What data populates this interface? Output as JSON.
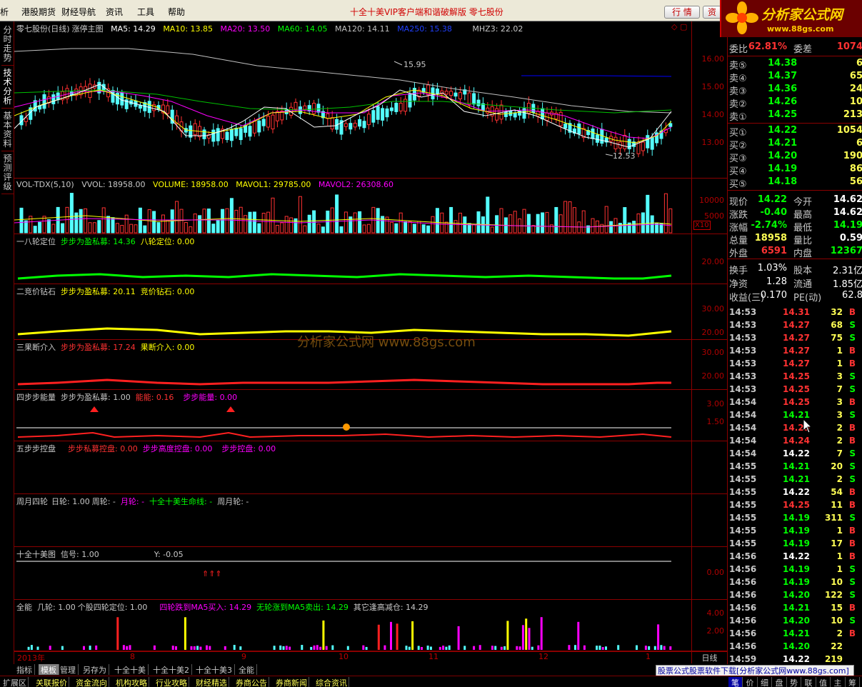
{
  "menu": {
    "items": [
      "析",
      "港股期货",
      "财经导航",
      "资讯",
      "工具",
      "帮助"
    ],
    "promo": "十全十美VIP客户端和谐破解版  零七股份",
    "btn_quote": "行 情",
    "btn_info": "资"
  },
  "logo": {
    "text": "分析家公式网",
    "url": "www.88gs.com"
  },
  "left_tabs": [
    "分时走势",
    "技术分析",
    "基本资料",
    "预测评级"
  ],
  "main": {
    "stock": "零七股份(日线)",
    "indicator": "涨停主图",
    "ma5": "MA5: 14.29",
    "ma10": "MA10: 13.85",
    "ma20": "MA20: 13.50",
    "ma60": "MA60: 14.05",
    "ma120": "MA120: 14.11",
    "ma250": "MA250: 15.38",
    "mhz3": "MHZ3: 22.02",
    "high": "15.95",
    "low": "12.53",
    "ticks": [
      "16.00",
      "15.00",
      "14.00",
      "13.00"
    ]
  },
  "vol": {
    "name": "VOL-TDX(5,10)",
    "vvol": "VVOL: 18958.00",
    "volume": "VOLUME: 18958.00",
    "mavol1": "MAVOL1: 29785.00",
    "mavol2": "MAVOL2: 26308.60",
    "ticks": [
      "10000",
      "5000"
    ],
    "unit": "X10"
  },
  "p1": {
    "name": "一八轮定位",
    "l1": "步步为盈私募: 14.36",
    "l2": "八轮定位: 0.00",
    "ticks": [
      "20.00"
    ]
  },
  "p2": {
    "name": "二竞价钻石",
    "l1": "步步为盈私募: 20.11",
    "l2": "竞价钻石: 0.00",
    "ticks": [
      "30.00",
      "20.00"
    ]
  },
  "p3": {
    "name": "三果断介入",
    "l1": "步步为盈私募: 17.24",
    "l2": "果断介入: 0.00",
    "ticks": [
      "30.00",
      "20.00"
    ]
  },
  "p4": {
    "name": "四步步能量",
    "l1": "步步为盈私募: 1.00",
    "l2": "能能: 0.16",
    "l3": "步步能量: 0.00",
    "ticks": [
      "3.00",
      "1.50"
    ]
  },
  "p5": {
    "name": "五步步控盘",
    "l1": "步步私募控盘: 0.00",
    "l2": "步步高度控盘: 0.00",
    "l3": "步步控盘: 0.00"
  },
  "p6": {
    "name": "周月四轮",
    "l1": "日轮: 1.00",
    "l2": "周轮: -",
    "l3": "月轮: -",
    "l4": "十全十美生命线: -",
    "l5": "周月轮: -"
  },
  "p7": {
    "name": "十全十美图",
    "l1": "信号: 1.00",
    "l2": "Y: -0.05",
    "ticks": [
      "0.00"
    ]
  },
  "p8": {
    "name": "全能",
    "l1": "几轮: 1.00",
    "l2": "个股四轮定位: 1.00",
    "l3": "四轮跌到MA5买入: 14.29",
    "l4": "无轮涨到MA5卖出: 14.29",
    "l5": "其它逢高减仓: 14.29",
    "ticks": [
      "4.00",
      "2.00"
    ]
  },
  "xaxis": {
    "labels": [
      "2013年",
      "8",
      "9",
      "10",
      "11",
      "12",
      "1"
    ],
    "period": "日线"
  },
  "watermark": "分析家公式网 www.88gs.com",
  "quote": {
    "weibi_label": "委比",
    "weibi": "62.81%",
    "weicha_label": "委差",
    "weicha": "1074",
    "sells": [
      {
        "l": "卖⑤",
        "p": "14.38",
        "v": "6"
      },
      {
        "l": "卖④",
        "p": "14.37",
        "v": "65"
      },
      {
        "l": "卖③",
        "p": "14.36",
        "v": "24"
      },
      {
        "l": "卖②",
        "p": "14.26",
        "v": "10"
      },
      {
        "l": "卖①",
        "p": "14.25",
        "v": "213"
      }
    ],
    "buys": [
      {
        "l": "买①",
        "p": "14.22",
        "v": "1054"
      },
      {
        "l": "买②",
        "p": "14.21",
        "v": "6"
      },
      {
        "l": "买③",
        "p": "14.20",
        "v": "190"
      },
      {
        "l": "买④",
        "p": "14.19",
        "v": "86"
      },
      {
        "l": "买⑤",
        "p": "14.18",
        "v": "56"
      }
    ],
    "stats": [
      {
        "l1": "现价",
        "v1": "14.22",
        "l2": "今开",
        "v2": "14.62"
      },
      {
        "l1": "涨跌",
        "v1": "-0.40",
        "l2": "最高",
        "v2": "14.62"
      },
      {
        "l1": "涨幅",
        "v1": "-2.74%",
        "l2": "最低",
        "v2": "14.19"
      },
      {
        "l1": "总量",
        "v1": "18958",
        "l2": "量比",
        "v2": "0.59"
      },
      {
        "l1": "外盘",
        "v1": "6591",
        "l2": "内盘",
        "v2": "12367"
      }
    ],
    "fin": [
      {
        "l1": "换手",
        "v1": "1.03%",
        "l2": "股本",
        "v2": "2.31亿"
      },
      {
        "l1": "净资",
        "v1": "1.28",
        "l2": "流通",
        "v2": "1.85亿"
      },
      {
        "l1": "收益(三)",
        "v1": "0.170",
        "l2": "PE(动)",
        "v2": "62.8"
      }
    ]
  },
  "trades": [
    {
      "t": "14:53",
      "p": "14.31",
      "v": "32",
      "bs": "B"
    },
    {
      "t": "14:53",
      "p": "14.27",
      "v": "68",
      "bs": "S"
    },
    {
      "t": "14:53",
      "p": "14.27",
      "v": "75",
      "bs": "S"
    },
    {
      "t": "14:53",
      "p": "14.27",
      "v": "1",
      "bs": "B"
    },
    {
      "t": "14:53",
      "p": "14.27",
      "v": "1",
      "bs": "B"
    },
    {
      "t": "14:53",
      "p": "14.25",
      "v": "3",
      "bs": "S"
    },
    {
      "t": "14:53",
      "p": "14.25",
      "v": "7",
      "bs": "S"
    },
    {
      "t": "14:54",
      "p": "14.25",
      "v": "3",
      "bs": "B"
    },
    {
      "t": "14:54",
      "p": "14.21",
      "v": "3",
      "bs": "S"
    },
    {
      "t": "14:54",
      "p": "14.25",
      "v": "2",
      "bs": "B"
    },
    {
      "t": "14:54",
      "p": "14.24",
      "v": "2",
      "bs": "B"
    },
    {
      "t": "14:54",
      "p": "14.22",
      "v": "7",
      "bs": "S"
    },
    {
      "t": "14:55",
      "p": "14.21",
      "v": "20",
      "bs": "S"
    },
    {
      "t": "14:55",
      "p": "14.21",
      "v": "2",
      "bs": "S"
    },
    {
      "t": "14:55",
      "p": "14.22",
      "v": "54",
      "bs": "B"
    },
    {
      "t": "14:55",
      "p": "14.25",
      "v": "11",
      "bs": "B"
    },
    {
      "t": "14:55",
      "p": "14.19",
      "v": "311",
      "bs": "S"
    },
    {
      "t": "14:55",
      "p": "14.19",
      "v": "1",
      "bs": "B"
    },
    {
      "t": "14:55",
      "p": "14.19",
      "v": "17",
      "bs": "B"
    },
    {
      "t": "14:56",
      "p": "14.22",
      "v": "1",
      "bs": "B"
    },
    {
      "t": "14:56",
      "p": "14.19",
      "v": "1",
      "bs": "S"
    },
    {
      "t": "14:56",
      "p": "14.19",
      "v": "10",
      "bs": "S"
    },
    {
      "t": "14:56",
      "p": "14.20",
      "v": "122",
      "bs": "S"
    },
    {
      "t": "14:56",
      "p": "14.21",
      "v": "15",
      "bs": "B"
    },
    {
      "t": "14:56",
      "p": "14.20",
      "v": "10",
      "bs": "S"
    },
    {
      "t": "14:56",
      "p": "14.21",
      "v": "2",
      "bs": "B"
    },
    {
      "t": "14:56",
      "p": "14.20",
      "v": "22",
      "bs": ""
    },
    {
      "t": "14:59",
      "p": "14.22",
      "v": "219",
      "bs": ""
    }
  ],
  "bottom_tabs": [
    "指标",
    "模板",
    "管理",
    "另存为",
    "十全十美",
    "十全十美2",
    "十全十美3",
    "全能"
  ],
  "bottom_tabs2": [
    "扩展区",
    "关联报价",
    "资金流向",
    "机构攻略",
    "行业攻略",
    "财经精选",
    "券商公告",
    "券商新闻",
    "综合资讯"
  ],
  "bottom_tabs3": [
    "笔",
    "价",
    "细",
    "盘",
    "势",
    "联",
    "值",
    "主",
    "筹"
  ],
  "download_banner": "股票公式股票软件下载[分析家公式网www.88gs.com]",
  "colors": {
    "up": "#ff3232",
    "down": "#54ffff",
    "ma5": "#ffffff",
    "ma10": "#ffff00",
    "ma20": "#ff00ff",
    "ma60": "#00ff00",
    "ma120": "#c0c0c0",
    "ma250": "#0000ff"
  }
}
